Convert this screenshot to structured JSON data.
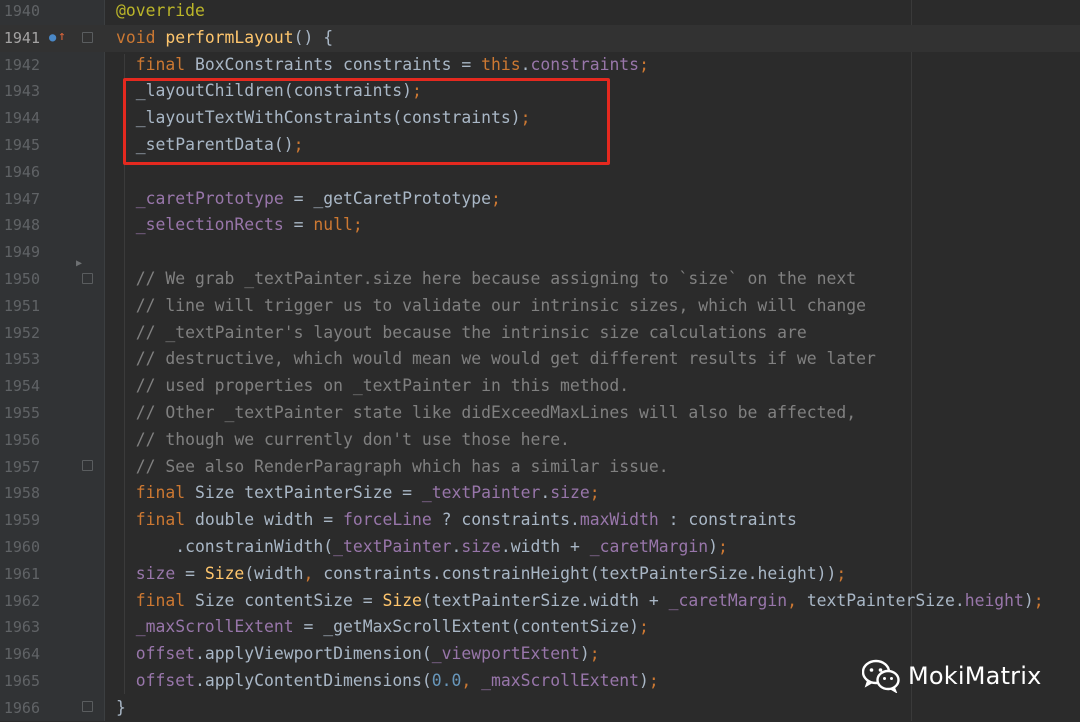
{
  "editor": {
    "lines": [
      {
        "num": "1940",
        "tokens": [
          [
            "ann",
            "@override"
          ]
        ]
      },
      {
        "num": "1941",
        "current": true,
        "tokens": [
          [
            "kw",
            "void "
          ],
          [
            "fn",
            "performLayout"
          ],
          [
            "ref",
            "() {"
          ]
        ]
      },
      {
        "num": "1942",
        "tokens": [
          [
            "kw",
            "  final "
          ],
          [
            "type",
            "BoxConstraints "
          ],
          [
            "ref",
            "constraints = "
          ],
          [
            "kw",
            "this"
          ],
          [
            "ref",
            "."
          ],
          [
            "field",
            "constraints"
          ],
          [
            "kw",
            ";"
          ]
        ]
      },
      {
        "num": "1943",
        "tokens": [
          [
            "ref",
            "  _layoutChildren(constraints)"
          ],
          [
            "kw",
            ";"
          ]
        ]
      },
      {
        "num": "1944",
        "tokens": [
          [
            "ref",
            "  _layoutTextWithConstraints(constraints)"
          ],
          [
            "kw",
            ";"
          ]
        ]
      },
      {
        "num": "1945",
        "tokens": [
          [
            "ref",
            "  _setParentData()"
          ],
          [
            "kw",
            ";"
          ]
        ]
      },
      {
        "num": "1946",
        "tokens": []
      },
      {
        "num": "1947",
        "tokens": [
          [
            "field",
            "  _caretPrototype "
          ],
          [
            "ref",
            "= "
          ],
          [
            "ref",
            "_getCaretPrototype"
          ],
          [
            "kw",
            ";"
          ]
        ]
      },
      {
        "num": "1948",
        "tokens": [
          [
            "field",
            "  _selectionRects "
          ],
          [
            "ref",
            "= "
          ],
          [
            "kw",
            "null;"
          ]
        ]
      },
      {
        "num": "1949",
        "tokens": []
      },
      {
        "num": "1950",
        "tokens": [
          [
            "cm",
            "  // We grab _textPainter.size here because assigning to `size` on the next"
          ]
        ]
      },
      {
        "num": "1951",
        "tokens": [
          [
            "cm",
            "  // line will trigger us to validate our intrinsic sizes, which will change"
          ]
        ]
      },
      {
        "num": "1952",
        "tokens": [
          [
            "cm",
            "  // _textPainter's layout because the intrinsic size calculations are"
          ]
        ]
      },
      {
        "num": "1953",
        "tokens": [
          [
            "cm",
            "  // destructive, which would mean we would get different results if we later"
          ]
        ]
      },
      {
        "num": "1954",
        "tokens": [
          [
            "cm",
            "  // used properties on _textPainter in this method."
          ]
        ]
      },
      {
        "num": "1955",
        "tokens": [
          [
            "cm",
            "  // Other _textPainter state like didExceedMaxLines will also be affected,"
          ]
        ]
      },
      {
        "num": "1956",
        "tokens": [
          [
            "cm",
            "  // though we currently don't use those here."
          ]
        ]
      },
      {
        "num": "1957",
        "tokens": [
          [
            "cm",
            "  // See also RenderParagraph which has a similar issue."
          ]
        ]
      },
      {
        "num": "1958",
        "tokens": [
          [
            "kw",
            "  final "
          ],
          [
            "type",
            "Size "
          ],
          [
            "ref",
            "textPainterSize = "
          ],
          [
            "field",
            "_textPainter"
          ],
          [
            "ref",
            "."
          ],
          [
            "field",
            "size"
          ],
          [
            "kw",
            ";"
          ]
        ]
      },
      {
        "num": "1959",
        "tokens": [
          [
            "kw",
            "  final "
          ],
          [
            "type",
            "double "
          ],
          [
            "ref",
            "width = "
          ],
          [
            "field",
            "forceLine "
          ],
          [
            "ref",
            "? constraints."
          ],
          [
            "field",
            "maxWidth "
          ],
          [
            "ref",
            ": constraints"
          ]
        ]
      },
      {
        "num": "1960",
        "tokens": [
          [
            "ref",
            "      .constrainWidth("
          ],
          [
            "field",
            "_textPainter"
          ],
          [
            "ref",
            "."
          ],
          [
            "field",
            "size"
          ],
          [
            "ref",
            ".width + "
          ],
          [
            "field",
            "_caretMargin"
          ],
          [
            "ref",
            ")"
          ],
          [
            "kw",
            ";"
          ]
        ]
      },
      {
        "num": "1961",
        "tokens": [
          [
            "field",
            "  size "
          ],
          [
            "ref",
            "= "
          ],
          [
            "fn",
            "Size"
          ],
          [
            "ref",
            "(width"
          ],
          [
            "kw",
            ", "
          ],
          [
            "ref",
            "constraints.constrainHeight(textPainterSize.height))"
          ],
          [
            "kw",
            ";"
          ]
        ]
      },
      {
        "num": "1962",
        "tokens": [
          [
            "kw",
            "  final "
          ],
          [
            "type",
            "Size "
          ],
          [
            "ref",
            "contentSize = "
          ],
          [
            "fn",
            "Size"
          ],
          [
            "ref",
            "(textPainterSize.width + "
          ],
          [
            "field",
            "_caretMargin"
          ],
          [
            "kw",
            ", "
          ],
          [
            "ref",
            "textPainterSize."
          ],
          [
            "field",
            "height"
          ],
          [
            "ref",
            ")"
          ],
          [
            "kw",
            ";"
          ]
        ]
      },
      {
        "num": "1963",
        "tokens": [
          [
            "field",
            "  _maxScrollExtent "
          ],
          [
            "ref",
            "= _getMaxScrollExtent(contentSize)"
          ],
          [
            "kw",
            ";"
          ]
        ]
      },
      {
        "num": "1964",
        "tokens": [
          [
            "field",
            "  offset"
          ],
          [
            "ref",
            ".applyViewportDimension("
          ],
          [
            "field",
            "_viewportExtent"
          ],
          [
            "ref",
            ")"
          ],
          [
            "kw",
            ";"
          ]
        ]
      },
      {
        "num": "1965",
        "tokens": [
          [
            "field",
            "  offset"
          ],
          [
            "ref",
            ".applyContentDimensions("
          ],
          [
            "num",
            "0.0"
          ],
          [
            "kw",
            ", "
          ],
          [
            "field",
            "_maxScrollExtent"
          ],
          [
            "ref",
            ")"
          ],
          [
            "kw",
            ";"
          ]
        ]
      },
      {
        "num": "1966",
        "tokens": [
          [
            "ref",
            "}"
          ]
        ]
      }
    ]
  },
  "watermark": {
    "text": "MokiMatrix",
    "icon": "wechat-icon"
  },
  "colors": {
    "highlight_box": "#e5291f",
    "background": "#2b2b2b"
  }
}
